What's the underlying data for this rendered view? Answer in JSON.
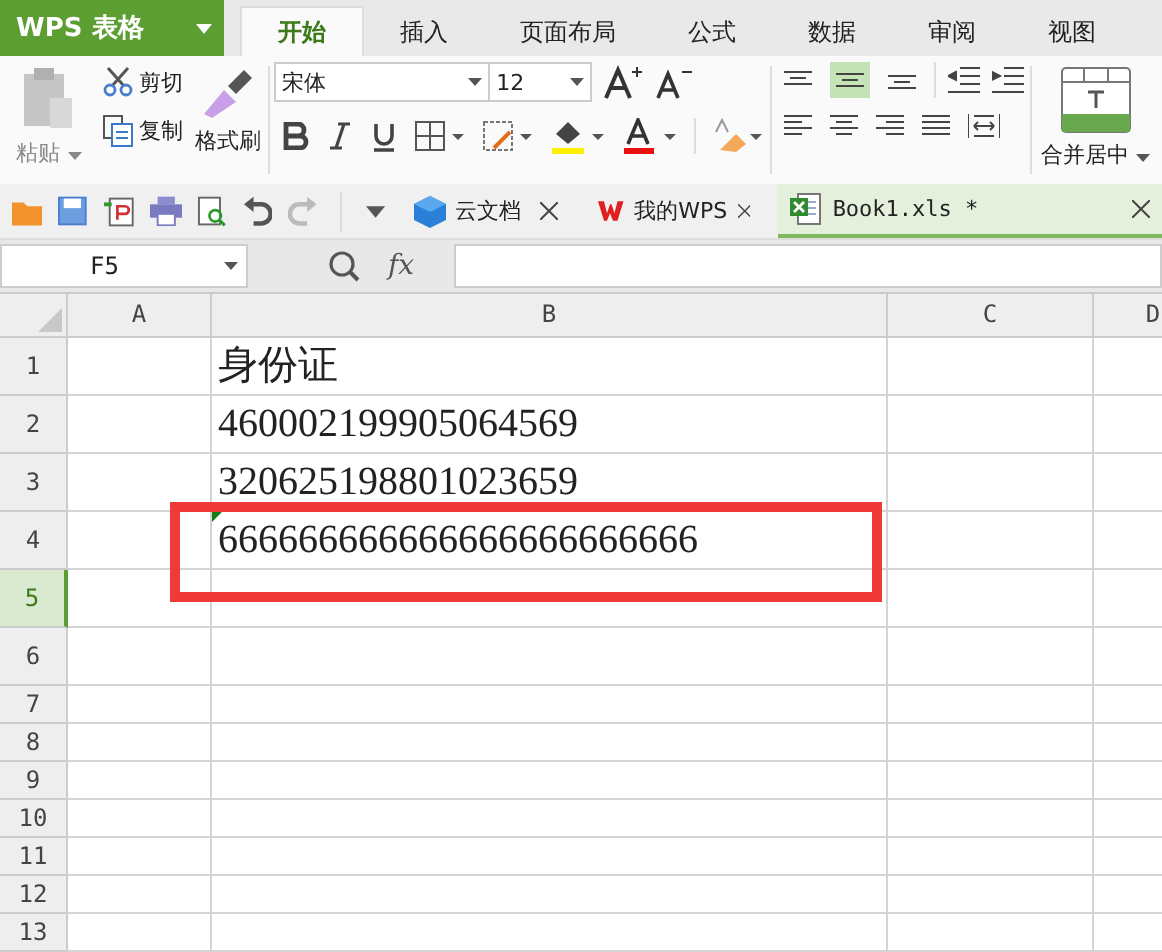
{
  "app": {
    "title": "WPS 表格"
  },
  "tabs": [
    {
      "label": "开始",
      "selected": true
    },
    {
      "label": "插入",
      "selected": false
    },
    {
      "label": "页面布局",
      "selected": false
    },
    {
      "label": "公式",
      "selected": false
    },
    {
      "label": "数据",
      "selected": false
    },
    {
      "label": "审阅",
      "selected": false
    },
    {
      "label": "视图",
      "selected": false
    }
  ],
  "clipboard": {
    "paste": "粘贴",
    "cut": "剪切",
    "copy": "复制",
    "format_painter": "格式刷"
  },
  "font": {
    "name": "宋体",
    "size": "12"
  },
  "vertical_align": [
    {
      "selected": false
    },
    {
      "selected": true
    },
    {
      "selected": false
    }
  ],
  "merge": {
    "label": "合并居中"
  },
  "doc_tabs": [
    {
      "label": "云文档",
      "kind": "cloud",
      "selected": false
    },
    {
      "label": "我的WPS",
      "kind": "wps",
      "selected": false
    },
    {
      "label": "Book1.xls *",
      "kind": "sheet",
      "selected": true
    }
  ],
  "formula_bar": {
    "cell_ref": "F5",
    "fx": "fx"
  },
  "sheet": {
    "columns": [
      {
        "label": "A",
        "selected": false
      },
      {
        "label": "B",
        "selected": false
      },
      {
        "label": "C",
        "selected": false
      },
      {
        "label": "D",
        "selected": false
      }
    ],
    "rows": [
      {
        "header": "1",
        "selected": false,
        "b": "身份证"
      },
      {
        "header": "2",
        "selected": false,
        "b": "460002199905064569"
      },
      {
        "header": "3",
        "selected": false,
        "b": "320625198801023659"
      },
      {
        "header": "4",
        "selected": false,
        "b": "666666666666666666666666",
        "text_flag": true
      },
      {
        "header": "5",
        "selected": true
      },
      {
        "header": "6",
        "selected": false
      },
      {
        "header": "7",
        "selected": false
      },
      {
        "header": "8",
        "selected": false
      },
      {
        "header": "9",
        "selected": false
      },
      {
        "header": "10",
        "selected": false
      },
      {
        "header": "11",
        "selected": false
      },
      {
        "header": "12",
        "selected": false
      },
      {
        "header": "13",
        "selected": false
      }
    ]
  }
}
